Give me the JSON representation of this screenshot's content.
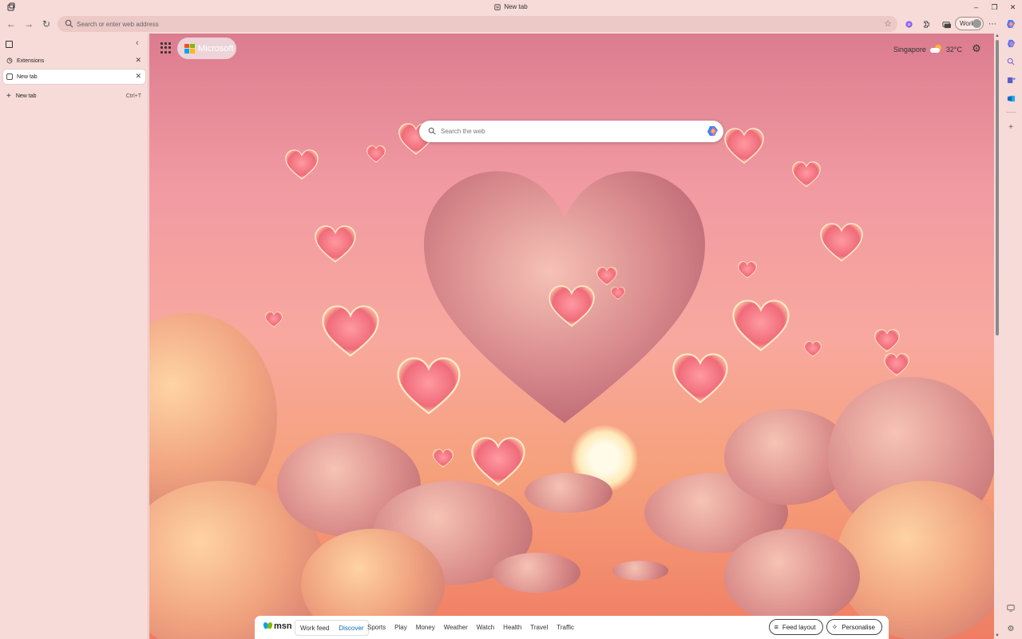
{
  "window": {
    "title": "New tab"
  },
  "toolbar": {
    "address_placeholder": "Search or enter web address",
    "profile_label": "Work"
  },
  "sidepane": {
    "tabs": [
      {
        "label": "Extensions",
        "active": false
      },
      {
        "label": "New tab",
        "active": true
      }
    ],
    "new_tab_label": "New tab",
    "new_tab_shortcut": "Ctrl+T"
  },
  "ntp": {
    "brand": "Microsoft",
    "weather_city": "Singapore",
    "weather_temp": "32°C",
    "search_placeholder": "Search the web"
  },
  "feed": {
    "logo_text": "msn",
    "tabs": [
      {
        "label": "Work feed",
        "selected": false
      },
      {
        "label": "Discover",
        "selected": true
      }
    ],
    "links": [
      "Sports",
      "Play",
      "Money",
      "Weather",
      "Watch",
      "Health",
      "Travel",
      "Traffic"
    ],
    "feed_layout_label": "Feed layout",
    "personalise_label": "Personalise"
  },
  "colors": {
    "window_bg": "#f6dbd8",
    "accent_blue": "#0f6cbd",
    "sky_top": "#dc7c8f",
    "sky_bottom": "#f07d63"
  }
}
